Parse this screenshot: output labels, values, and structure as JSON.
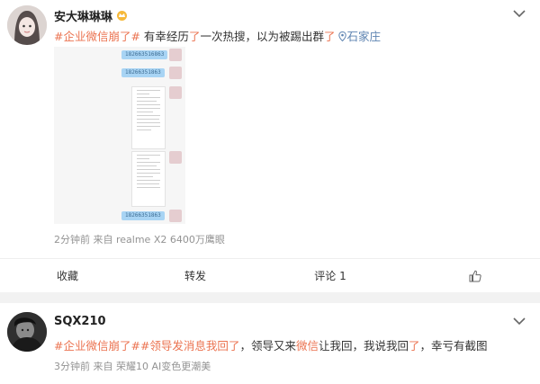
{
  "post1": {
    "author": "安大琳琳琳",
    "text": {
      "tag": "#企业微信崩了#",
      "part1": " 有幸经历",
      "hl1": "了",
      "part2": "一次热搜，以为被踢出群",
      "hl2": "了",
      "location": "石家庄"
    },
    "screenshot": {
      "bubble_texts": [
        "182663516863",
        "18266351863",
        "18266351863"
      ]
    },
    "meta": "2分钟前  来自 realme X2 6400万鹰眼",
    "actions": {
      "collect": "收藏",
      "repost": "转发",
      "comment": "评论 1"
    }
  },
  "post2": {
    "author": "SQX210",
    "text": {
      "tag1": "#企业微信崩了#",
      "tag2": "#领导发消息我回",
      "hl1": "了",
      "part1": "，领导又来",
      "hl2": "微信",
      "part2": "让我回，我说我回",
      "hl3": "了",
      "part3": "，幸亏有截图"
    },
    "meta": "3分钟前  来自 荣耀10 AI变色更潮美"
  },
  "colors": {
    "tag": "#eb7350",
    "location": "#5d83b1",
    "meta": "#939393",
    "bubble": "#a8d4f4"
  },
  "icons": [
    "crown-icon",
    "chevron-down-icon",
    "location-pin-icon",
    "like-icon"
  ]
}
